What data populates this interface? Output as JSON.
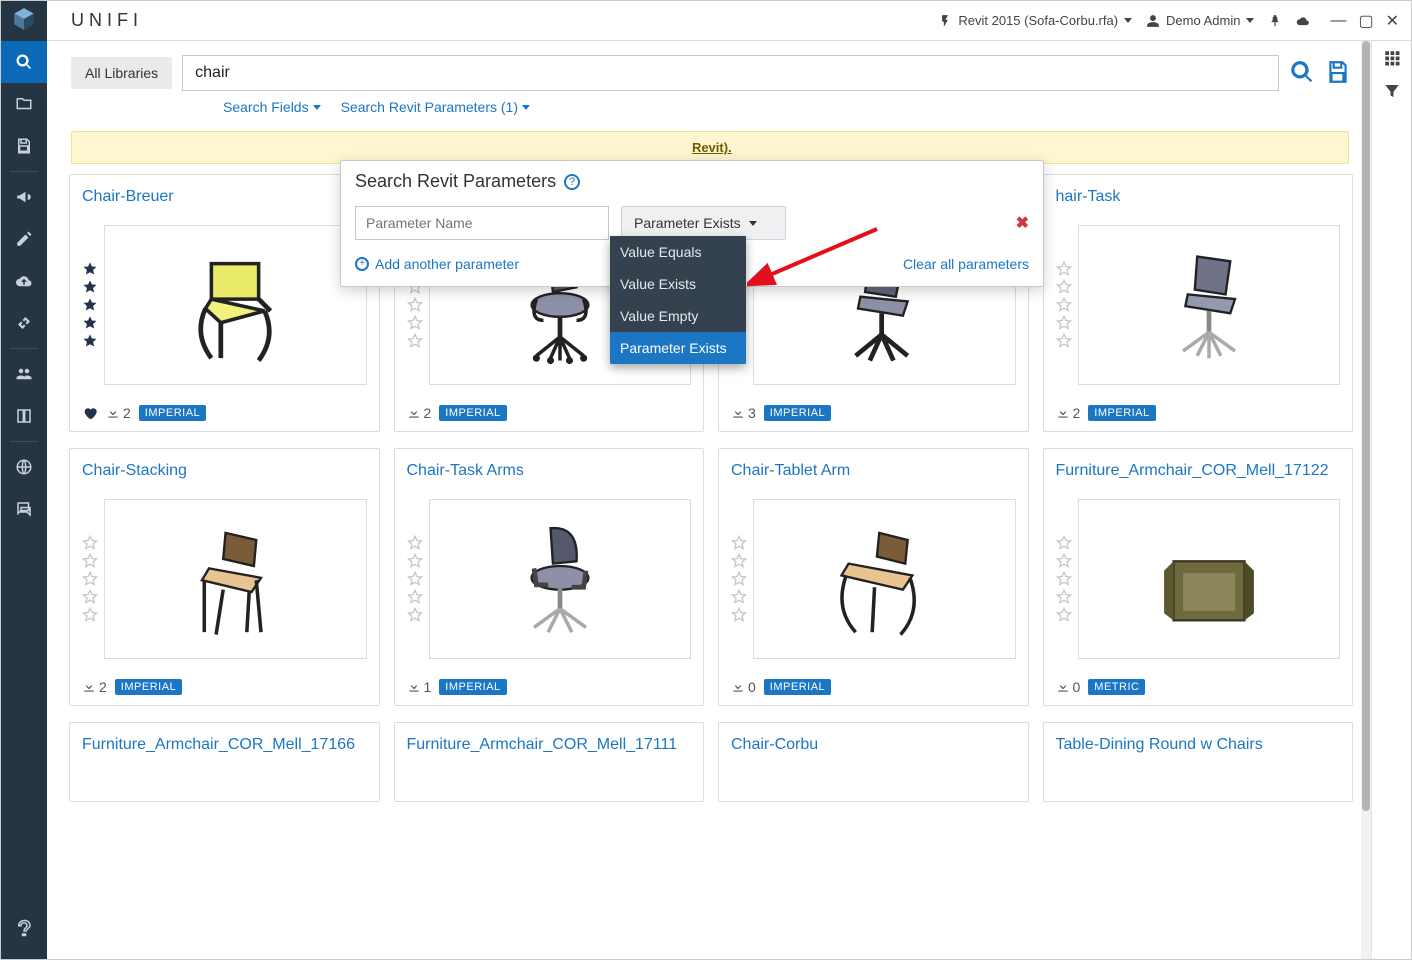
{
  "brand": "UNIFI",
  "header": {
    "revit_file": "Revit 2015 (Sofa-Corbu.rfa)",
    "user": "Demo Admin"
  },
  "search": {
    "lib_button": "All Libraries",
    "query": "chair",
    "fields_label": "Search Fields",
    "params_label": "Search Revit Parameters (1)"
  },
  "banner": {
    "suffix_link": "Revit)."
  },
  "popover": {
    "title": "Search Revit Parameters",
    "param_placeholder": "Parameter Name",
    "select_label": "Parameter Exists",
    "add_label": "Add another parameter",
    "clear_label": "Clear all parameters",
    "options": [
      "Value Equals",
      "Value Exists",
      "Value Empty",
      "Parameter Exists"
    ],
    "selected_index": 3
  },
  "cards": [
    {
      "title": "Chair-Breuer",
      "downloads": 2,
      "badge": "IMPERIAL",
      "fav": true,
      "rating": 5
    },
    {
      "title": "",
      "downloads": 2,
      "badge": "IMPERIAL",
      "fav": false,
      "rating": 0
    },
    {
      "title": "",
      "downloads": 3,
      "badge": "IMPERIAL",
      "fav": false,
      "rating": 0
    },
    {
      "title": "hair-Task",
      "downloads": 2,
      "badge": "IMPERIAL",
      "fav": false,
      "rating": 0
    },
    {
      "title": "Chair-Stacking",
      "downloads": 2,
      "badge": "IMPERIAL",
      "fav": false,
      "rating": 0
    },
    {
      "title": "Chair-Task Arms",
      "downloads": 1,
      "badge": "IMPERIAL",
      "fav": false,
      "rating": 0
    },
    {
      "title": "Chair-Tablet Arm",
      "downloads": 0,
      "badge": "IMPERIAL",
      "fav": false,
      "rating": 0
    },
    {
      "title": "Furniture_Armchair_COR_Mell_17122",
      "downloads": 0,
      "badge": "METRIC",
      "fav": false,
      "rating": 0
    },
    {
      "title": "Furniture_Armchair_COR_Mell_17166",
      "downloads": null,
      "badge": "",
      "fav": false,
      "rating": 0
    },
    {
      "title": "Furniture_Armchair_COR_Mell_17111",
      "downloads": null,
      "badge": "",
      "fav": false,
      "rating": 0
    },
    {
      "title": "Chair-Corbu",
      "downloads": null,
      "badge": "",
      "fav": false,
      "rating": 0
    },
    {
      "title": "Table-Dining Round w Chairs",
      "downloads": null,
      "badge": "",
      "fav": false,
      "rating": 0
    }
  ]
}
